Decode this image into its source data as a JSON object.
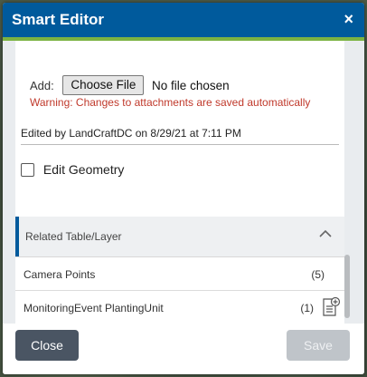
{
  "titlebar": {
    "title": "Smart Editor",
    "close_glyph": "×"
  },
  "attachments": {
    "add_label": "Add:",
    "file_button": "Choose File",
    "file_status": "No file chosen",
    "warning": "Warning: Changes to attachments are saved automatically"
  },
  "edited_by": "Edited by LandCraftDC on 8/29/21 at 7:11 PM",
  "edit_geometry": {
    "label": "Edit Geometry",
    "checked": false
  },
  "related": {
    "header": "Related Table/Layer",
    "items": [
      {
        "name": "Camera Points",
        "count": "(5)"
      },
      {
        "name": "MonitoringEvent PlantingUnit",
        "count": "(1)"
      }
    ]
  },
  "footer": {
    "close_label": "Close",
    "save_label": "Save"
  },
  "colors": {
    "header": "#005a9c",
    "accent_green": "#7cb342",
    "warning": "#c0392b"
  },
  "icons": [
    "close-icon",
    "checkbox",
    "chevron-up-icon",
    "add-related-record-icon"
  ]
}
